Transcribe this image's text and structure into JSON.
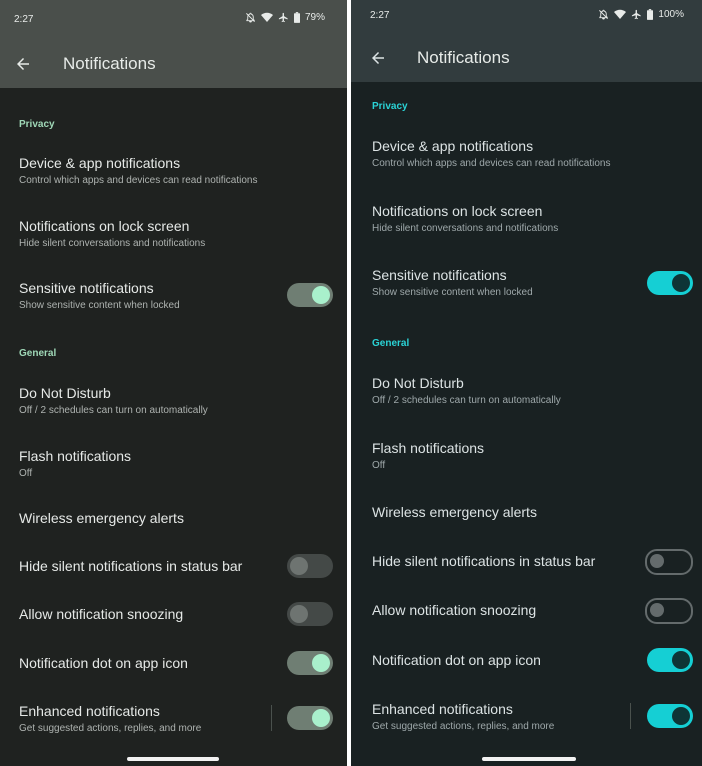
{
  "left": {
    "status": {
      "time": "2:27",
      "battery": "79%"
    },
    "title": "Notifications",
    "privacy_label": "Privacy",
    "general_label": "General",
    "items": [
      {
        "title": "Device & app notifications",
        "subtitle": "Control which apps and devices can read notifications"
      },
      {
        "title": "Notifications on lock screen",
        "subtitle": "Hide silent conversations and notifications"
      },
      {
        "title": "Sensitive notifications",
        "subtitle": "Show sensitive content when locked",
        "toggle": "on"
      },
      {
        "title": "Do Not Disturb",
        "subtitle": "Off / 2 schedules can turn on automatically"
      },
      {
        "title": "Flash notifications",
        "subtitle": "Off"
      },
      {
        "title": "Wireless emergency alerts"
      },
      {
        "title": "Hide silent notifications in status bar",
        "toggle": "off"
      },
      {
        "title": "Allow notification snoozing",
        "toggle": "off"
      },
      {
        "title": "Notification dot on app icon",
        "toggle": "on"
      },
      {
        "title": "Enhanced notifications",
        "subtitle": "Get suggested actions, replies, and more",
        "toggle": "on"
      }
    ]
  },
  "right": {
    "status": {
      "time": "2:27",
      "battery": "100%"
    },
    "title": "Notifications",
    "privacy_label": "Privacy",
    "general_label": "General",
    "items": [
      {
        "title": "Device & app notifications",
        "subtitle": "Control which apps and devices can read notifications"
      },
      {
        "title": "Notifications on lock screen",
        "subtitle": "Hide silent conversations and notifications"
      },
      {
        "title": "Sensitive notifications",
        "subtitle": "Show sensitive content when locked",
        "toggle": "on"
      },
      {
        "title": "Do Not Disturb",
        "subtitle": "Off / 2 schedules can turn on automatically"
      },
      {
        "title": "Flash notifications",
        "subtitle": "Off"
      },
      {
        "title": "Wireless emergency alerts"
      },
      {
        "title": "Hide silent notifications in status bar",
        "toggle": "off"
      },
      {
        "title": "Allow notification snoozing",
        "toggle": "off"
      },
      {
        "title": "Notification dot on app icon",
        "toggle": "on"
      },
      {
        "title": "Enhanced notifications",
        "subtitle": "Get suggested actions, replies, and more",
        "toggle": "on"
      }
    ]
  },
  "colors": {
    "left_accent": "#a9f0cc",
    "right_accent": "#15cfd4"
  }
}
